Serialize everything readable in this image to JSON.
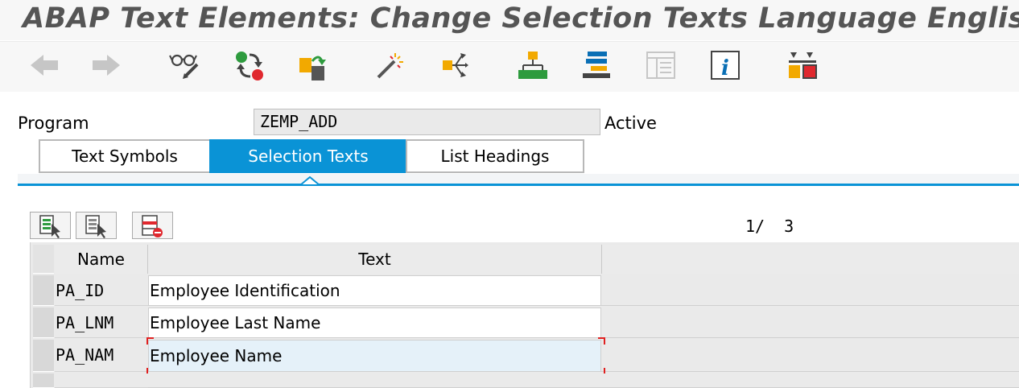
{
  "window": {
    "title": "ABAP Text Elements: Change Selection Texts Language English"
  },
  "toolbar": {
    "buttons": [
      {
        "name": "back",
        "icon": "arrow-left-icon",
        "enabled": false
      },
      {
        "name": "forward",
        "icon": "arrow-right-icon",
        "enabled": false
      },
      {
        "name": "display-change",
        "icon": "glasses-pencil-icon",
        "enabled": true
      },
      {
        "name": "active-inactive",
        "icon": "activate-cycle-icon",
        "enabled": true
      },
      {
        "name": "copy-to",
        "icon": "copy-object-icon",
        "enabled": true
      },
      {
        "name": "wizard",
        "icon": "magic-wand-icon",
        "enabled": true
      },
      {
        "name": "where-used",
        "icon": "where-used-icon",
        "enabled": true
      },
      {
        "name": "hierarchy",
        "icon": "hierarchy-icon",
        "enabled": true
      },
      {
        "name": "other-object",
        "icon": "stack-icon",
        "enabled": true
      },
      {
        "name": "screen-layout",
        "icon": "layout-icon",
        "enabled": false
      },
      {
        "name": "information",
        "icon": "info-icon",
        "enabled": true
      },
      {
        "name": "merge",
        "icon": "merge-icon",
        "enabled": true
      }
    ],
    "colors": {
      "green": "#2e9b3e",
      "red": "#e0282e",
      "orange": "#f2a900",
      "blue": "#0a6fb5",
      "gray": "#c6c6c6"
    }
  },
  "header": {
    "program_label": "Program",
    "program_value": "ZEMP_ADD",
    "status": "Active"
  },
  "tabs": [
    {
      "label": "Text Symbols",
      "active": false
    },
    {
      "label": "Selection Texts",
      "active": true
    },
    {
      "label": "List Headings",
      "active": false
    }
  ],
  "table_control": {
    "buttons": [
      {
        "name": "select-all",
        "icon": "select-all-icon"
      },
      {
        "name": "deselect-all",
        "icon": "deselect-all-icon"
      },
      {
        "name": "delete-row",
        "icon": "delete-row-icon"
      }
    ],
    "page_counter": "1/  3"
  },
  "table": {
    "columns": [
      "Name",
      "Text"
    ],
    "rows": [
      {
        "name": "PA_ID",
        "text": "Employee Identification"
      },
      {
        "name": "PA_LNM",
        "text": "Employee Last Name"
      },
      {
        "name": "PA_NAM",
        "text": "Employee Name"
      }
    ],
    "focused_row": 2
  },
  "colors": {
    "accent": "#0a93d6",
    "focus_corner": "#e02020",
    "focused_cell": "#e5f1f9"
  }
}
